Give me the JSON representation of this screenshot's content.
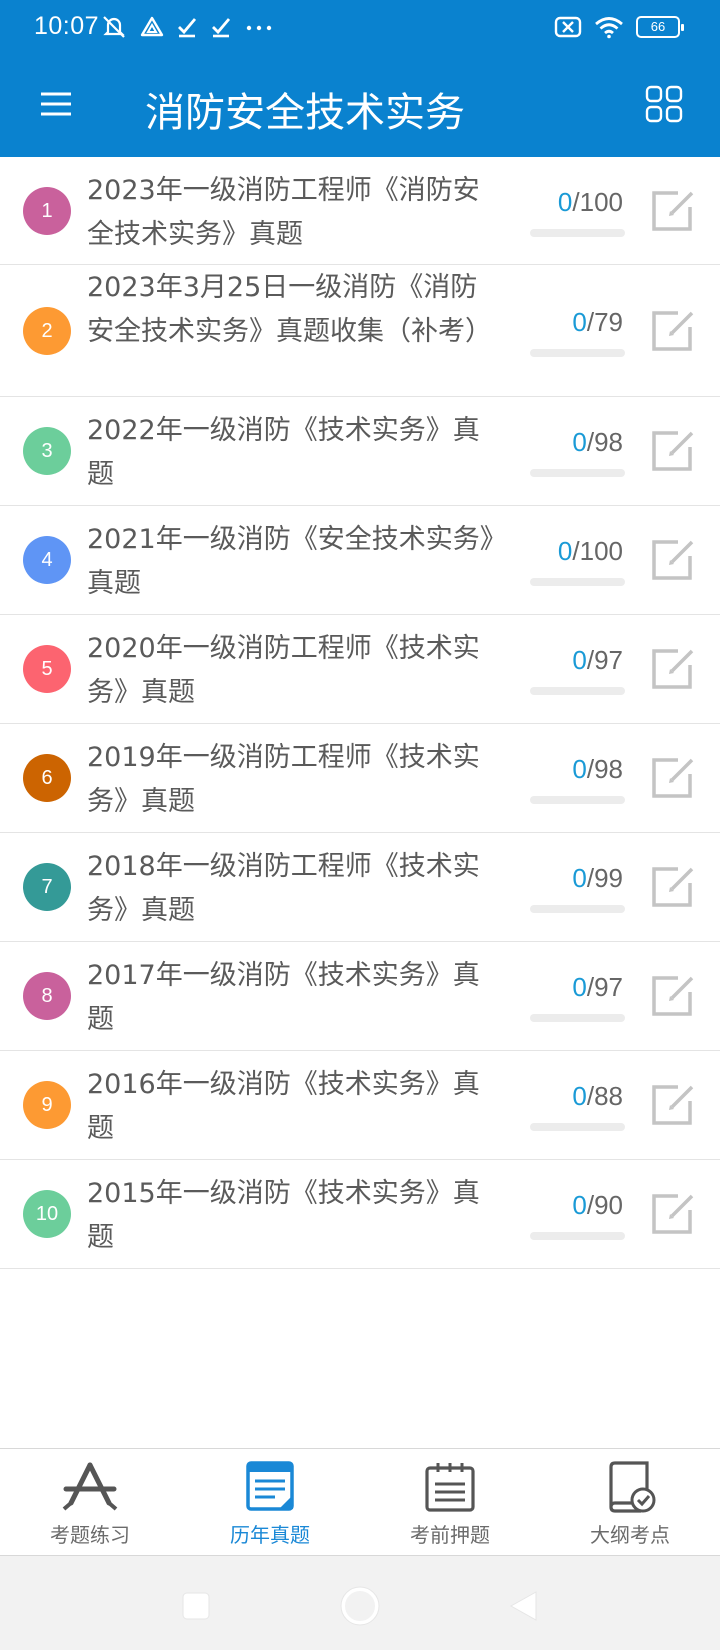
{
  "status_bar": {
    "time": "10:07",
    "battery": "66",
    "left_icons": [
      "mute-icon",
      "drive-icon",
      "check-icon",
      "check-icon",
      "more-icon"
    ],
    "right_icons": [
      "sim-off-icon",
      "wifi-icon",
      "battery-icon"
    ]
  },
  "app_bar": {
    "title": "消防安全技术实务",
    "menu_icon": "hamburger-icon",
    "action_icon": "grid-icon"
  },
  "accent_color": "#0a82cf",
  "progress_color": "#1a9ad6",
  "exams": [
    {
      "index": "1",
      "title": "2023年一级消防工程师《消防安全技术实务》真题",
      "done": "0",
      "total": "/100",
      "progress": 0,
      "badge_color": "#c9619c"
    },
    {
      "index": "2",
      "title": "2023年3月25日一级消防《消防安全技术实务》真题收集（补考）",
      "done": "0",
      "total": "/79",
      "progress": 0,
      "badge_color": "#fd9a33"
    },
    {
      "index": "3",
      "title": "2022年一级消防《技术实务》真题",
      "done": "0",
      "total": "/98",
      "progress": 0,
      "badge_color": "#6cce9b"
    },
    {
      "index": "4",
      "title": "2021年一级消防《安全技术实务》真题",
      "done": "0",
      "total": "/100",
      "progress": 0,
      "badge_color": "#5f95f5"
    },
    {
      "index": "5",
      "title": "2020年一级消防工程师《技术实务》真题",
      "done": "0",
      "total": "/97",
      "progress": 0,
      "badge_color": "#fc6470"
    },
    {
      "index": "6",
      "title": "2019年一级消防工程师《技术实务》真题",
      "done": "0",
      "total": "/98",
      "progress": 0,
      "badge_color": "#cc6401"
    },
    {
      "index": "7",
      "title": "2018年一级消防工程师《技术实务》真题",
      "done": "0",
      "total": "/99",
      "progress": 0,
      "badge_color": "#349a97"
    },
    {
      "index": "8",
      "title": "2017年一级消防《技术实务》真题",
      "done": "0",
      "total": "/97",
      "progress": 0,
      "badge_color": "#c9619c"
    },
    {
      "index": "9",
      "title": "2016年一级消防《技术实务》真题",
      "done": "0",
      "total": "/88",
      "progress": 0,
      "badge_color": "#fd9a33"
    },
    {
      "index": "10",
      "title": "2015年一级消防《技术实务》真题",
      "done": "0",
      "total": "/90",
      "progress": 0,
      "badge_color": "#6cce9b"
    }
  ],
  "bottom_nav": [
    {
      "label": "考题练习",
      "icon": "practice-icon",
      "active": false
    },
    {
      "label": "历年真题",
      "icon": "past-papers-icon",
      "active": true
    },
    {
      "label": "考前押题",
      "icon": "notepad-icon",
      "active": false
    },
    {
      "label": "大纲考点",
      "icon": "outline-book-icon",
      "active": false
    }
  ]
}
